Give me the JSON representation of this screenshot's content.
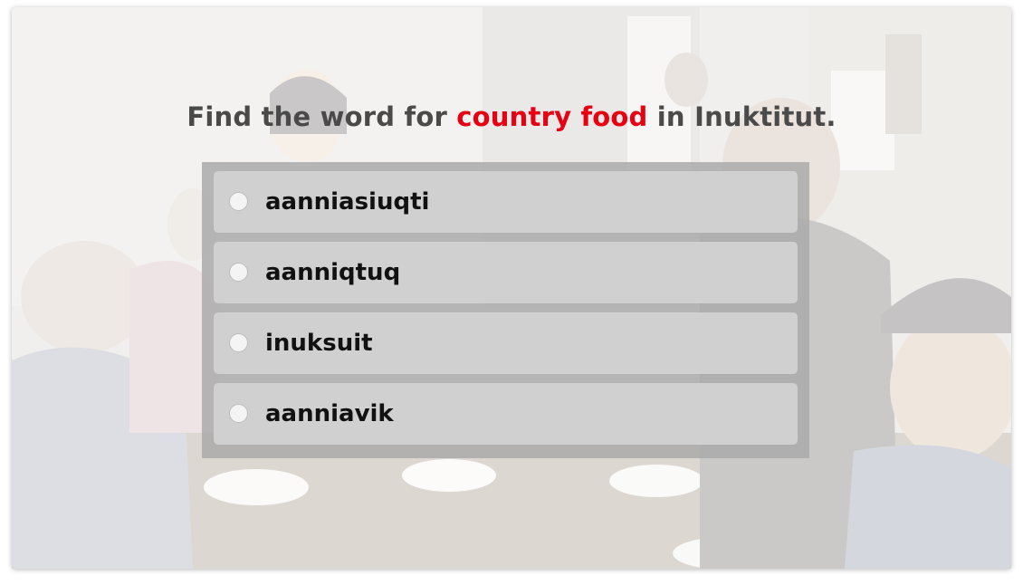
{
  "quiz": {
    "question_prefix": "Find the word for ",
    "question_highlight": "country food",
    "question_suffix": " in Inuktitut.",
    "highlight_color": "#e60012",
    "options": [
      {
        "label": "aanniasiuqti",
        "selected": false
      },
      {
        "label": "aanniqtuq",
        "selected": false
      },
      {
        "label": "inuksuit",
        "selected": false
      },
      {
        "label": "aanniavik",
        "selected": false
      }
    ]
  },
  "background": {
    "icon": "faded-photo-group-at-table"
  }
}
